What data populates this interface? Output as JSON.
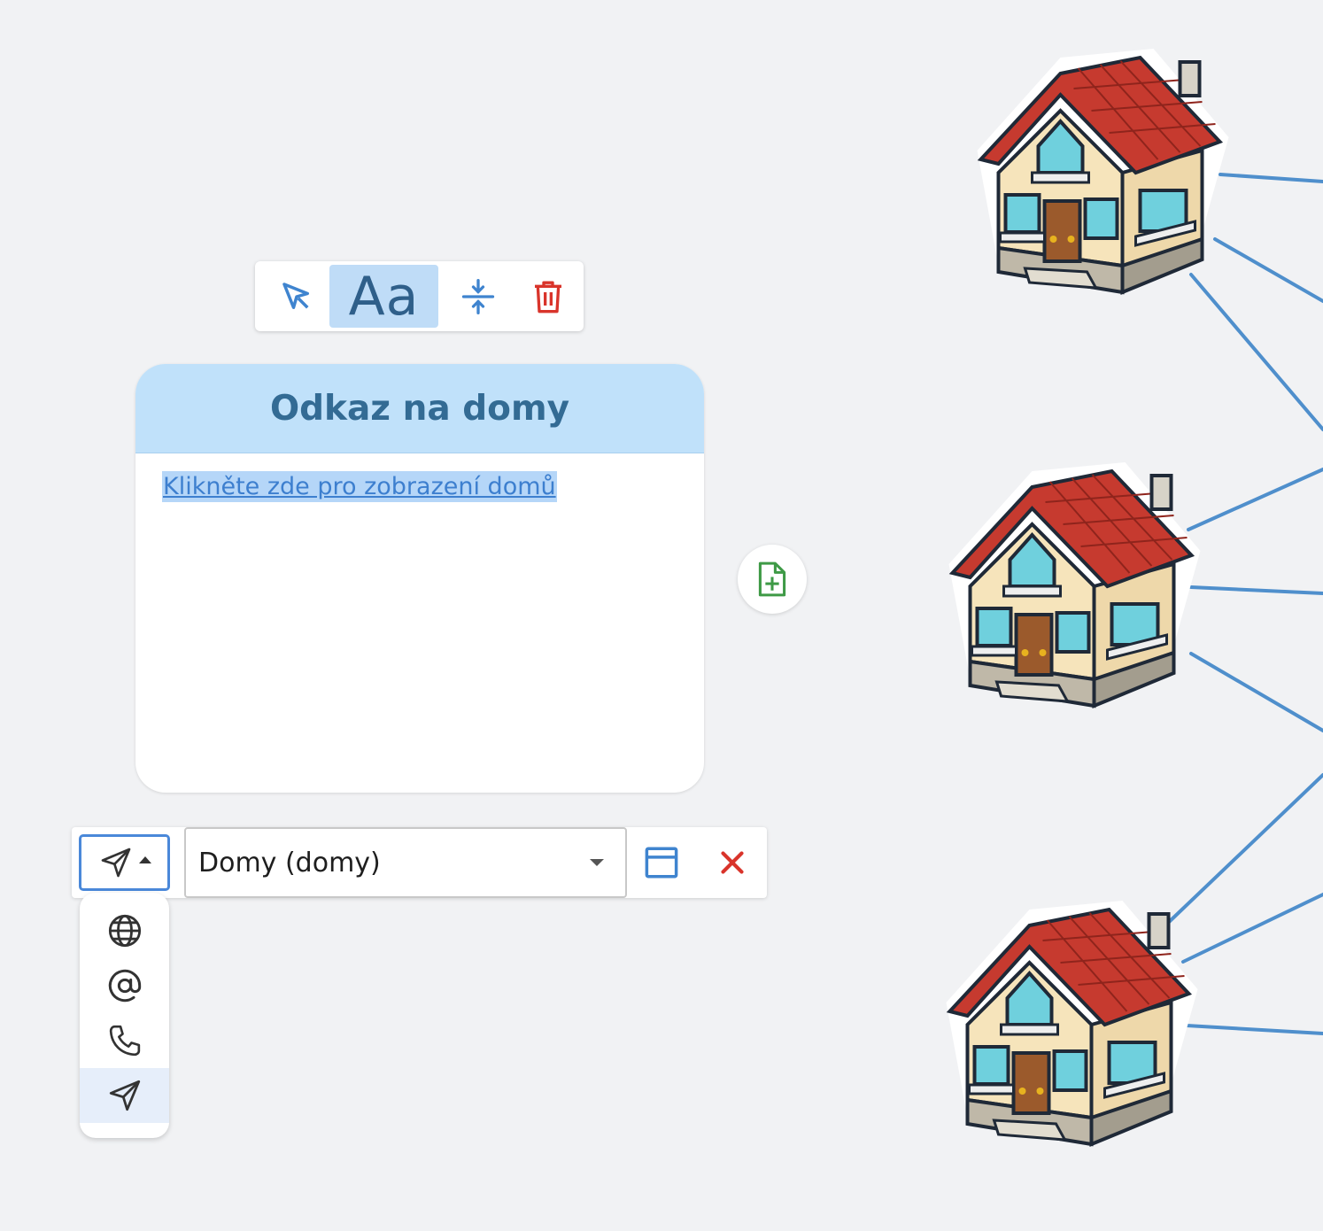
{
  "toolbar": {
    "text_style_label": "Aa",
    "tools": [
      "select-tool",
      "text-style",
      "collapse",
      "delete"
    ]
  },
  "card": {
    "title": "Odkaz na domy",
    "link_text": "Klikněte zde pro zobrazení domů"
  },
  "link_editor": {
    "selected_target": "Domy (domy)",
    "type_options": [
      "globe-icon",
      "at-icon",
      "phone-icon",
      "navigate-icon"
    ],
    "selected_type": "navigate-icon"
  },
  "colors": {
    "accent": "#4a88d9",
    "header": "#c0e1fa",
    "delete": "#d9342b",
    "add": "#3e9a46",
    "connector": "#4f8fcc"
  }
}
